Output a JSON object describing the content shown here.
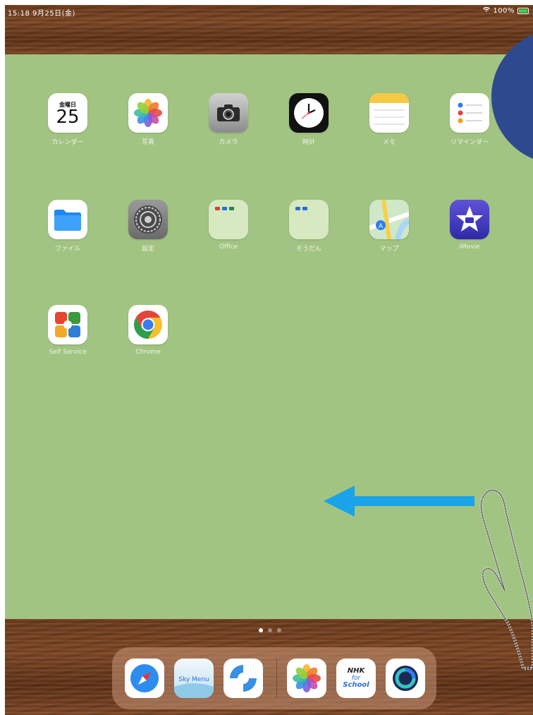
{
  "statusbar": {
    "time_date": "15:18 9月25日(金)",
    "battery": "100%"
  },
  "apps": [
    {
      "label": "カレンダー",
      "weekday": "金曜日",
      "day": "25"
    },
    {
      "label": "写真"
    },
    {
      "label": "カメラ"
    },
    {
      "label": "時計"
    },
    {
      "label": "メモ"
    },
    {
      "label": "リマインダー"
    },
    {
      "label": "ファイル"
    },
    {
      "label": "設定"
    },
    {
      "label": "Office"
    },
    {
      "label": "そうだん"
    },
    {
      "label": "マップ"
    },
    {
      "label": "iMovie"
    },
    {
      "label": "Self Service"
    },
    {
      "label": "Chrome"
    }
  ],
  "dock": {
    "apps": [
      {
        "icon": "safari-icon"
      },
      {
        "icon": "sky-menu-icon",
        "text": "Sky Menu"
      },
      {
        "icon": "lifebuoy-icon"
      },
      {
        "icon": "photos-icon"
      },
      {
        "icon": "nhk-for-school-icon",
        "text_line1": "NHK",
        "text_line2": "for",
        "text_line3": "School"
      },
      {
        "icon": "webex-icon"
      }
    ]
  },
  "colors": {
    "wallpaper_green": "#a2c483",
    "wood": "#6b3a1b",
    "arrow": "#1aa3e8",
    "corner_circle": "#2e4a8f"
  }
}
